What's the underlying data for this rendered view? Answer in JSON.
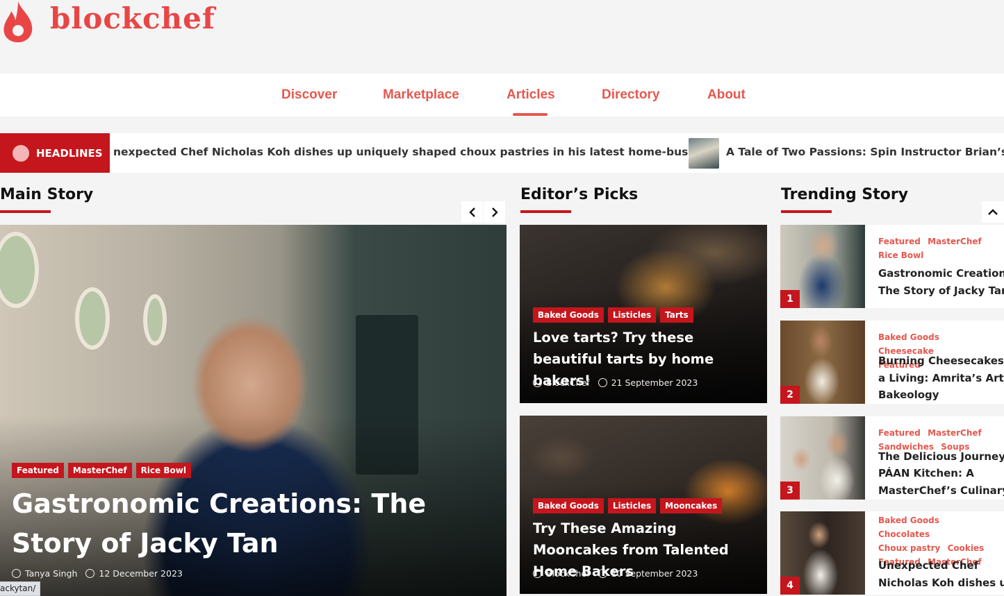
{
  "brand": {
    "name": "blockchef",
    "color": "#e84646"
  },
  "nav": {
    "items": [
      {
        "label": "Discover"
      },
      {
        "label": "Marketplace"
      },
      {
        "label": "Articles"
      },
      {
        "label": "Directory"
      },
      {
        "label": "About"
      }
    ],
    "active": "Articles"
  },
  "ticker": {
    "badge": "HEADLINES",
    "items": [
      "nexpected Chef Nicholas Koh dishes up uniquely shaped choux pastries in his latest home-business",
      "A Tale of Two Passions: Spin Instructor Brian’s Porky"
    ]
  },
  "sections": {
    "main": "Main Story",
    "picks": "Editor’s Picks",
    "trending": "Trending Story"
  },
  "main_story": {
    "tags": [
      "Featured",
      "MasterChef",
      "Rice Bowl"
    ],
    "title": "Gastronomic Creations: The Story of Jacky Tan",
    "author": "Tanya Singh",
    "date": "12 December 2023",
    "prev_icon": "chevron-left-icon",
    "next_icon": "chevron-right-icon"
  },
  "picks": [
    {
      "tags": [
        "Baked Goods",
        "Listicles",
        "Tarts"
      ],
      "title": "Love tarts? Try these beautiful tarts by home bakers!",
      "author": "BlockChef",
      "date": "21 September 2023"
    },
    {
      "tags": [
        "Baked Goods",
        "Listicles",
        "Mooncakes"
      ],
      "title": "Try These Amazing Mooncakes from Talented Home Bakers",
      "author": "BlockChef",
      "date": "10 September 2023"
    }
  ],
  "trending": [
    {
      "num": "1",
      "cats": [
        "Featured",
        "MasterChef",
        "Rice Bowl"
      ],
      "title_lines": [
        "Gastronomic Creations:",
        "The Story of Jacky Tan"
      ]
    },
    {
      "num": "2",
      "cats": [
        "Baked Goods",
        "Cheesecake",
        "Featured"
      ],
      "title_lines": [
        "Burning Cheesecakes fo",
        "a Living: Amrita’s Artisa",
        "Bakeology"
      ]
    },
    {
      "num": "3",
      "cats": [
        "Featured",
        "MasterChef",
        "Sandwiches",
        "Soups"
      ],
      "title_lines": [
        "The Delicious Journey o",
        "PÁAN Kitchen: A",
        "MasterChef’s Culinary"
      ]
    },
    {
      "num": "4",
      "cats": [
        "Baked Goods",
        "Chocolates",
        "Choux pastry",
        "Cookies",
        "Featured",
        "MasterChef"
      ],
      "title_lines": [
        "Unexpected Chef",
        "Nicholas Koh dishes up"
      ]
    }
  ],
  "status_bar": {
    "url": "ackytan/"
  },
  "colors": {
    "accent": "#c5161d",
    "nav": "#e4584e"
  }
}
